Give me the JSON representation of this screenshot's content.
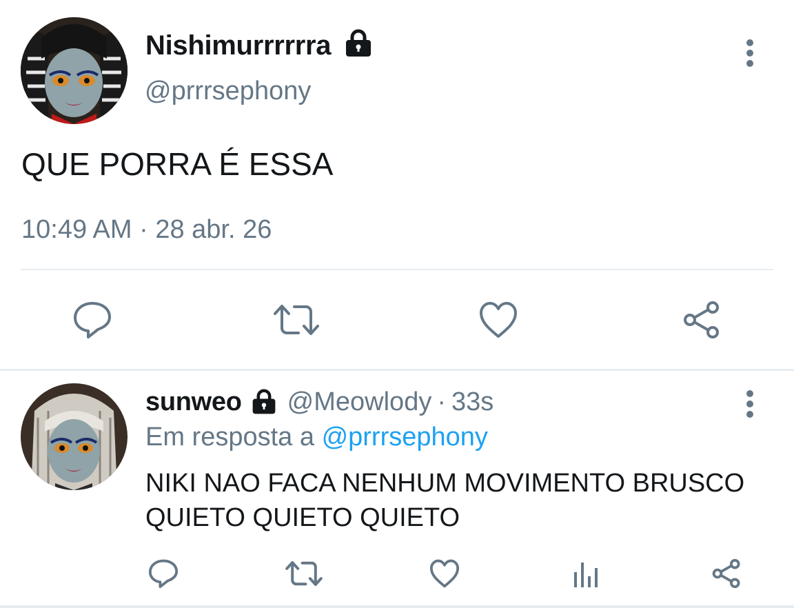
{
  "main_tweet": {
    "display_name": "Nishimurrrrrra",
    "handle": "@prrrsephony",
    "text": "QUE PORRA É ESSA",
    "timestamp": "10:49 AM · 28 abr. 26",
    "icons": {
      "lock": "lock-icon",
      "more": "more-vertical-icon",
      "actions": [
        "reply-icon",
        "retweet-icon",
        "like-icon",
        "share-icon"
      ]
    }
  },
  "reply": {
    "display_name": "sunweo",
    "handle": "@Meowlody",
    "separator": "·",
    "time_ago": "33s",
    "reply_prefix": "Em resposta a ",
    "reply_to": "@prrrsephony",
    "text": "NIKI NAO FACA NENHUM MOVIMENTO BRUSCO QUIETO QUIETO QUIETO",
    "icons": {
      "lock": "lock-icon",
      "more": "more-vertical-icon",
      "actions": [
        "reply-icon",
        "retweet-icon",
        "like-icon",
        "analytics-icon",
        "share-icon"
      ]
    }
  },
  "colors": {
    "text": "#14171a",
    "secondary": "#657786",
    "link": "#1da1f2",
    "divider": "#e6ecf0"
  }
}
